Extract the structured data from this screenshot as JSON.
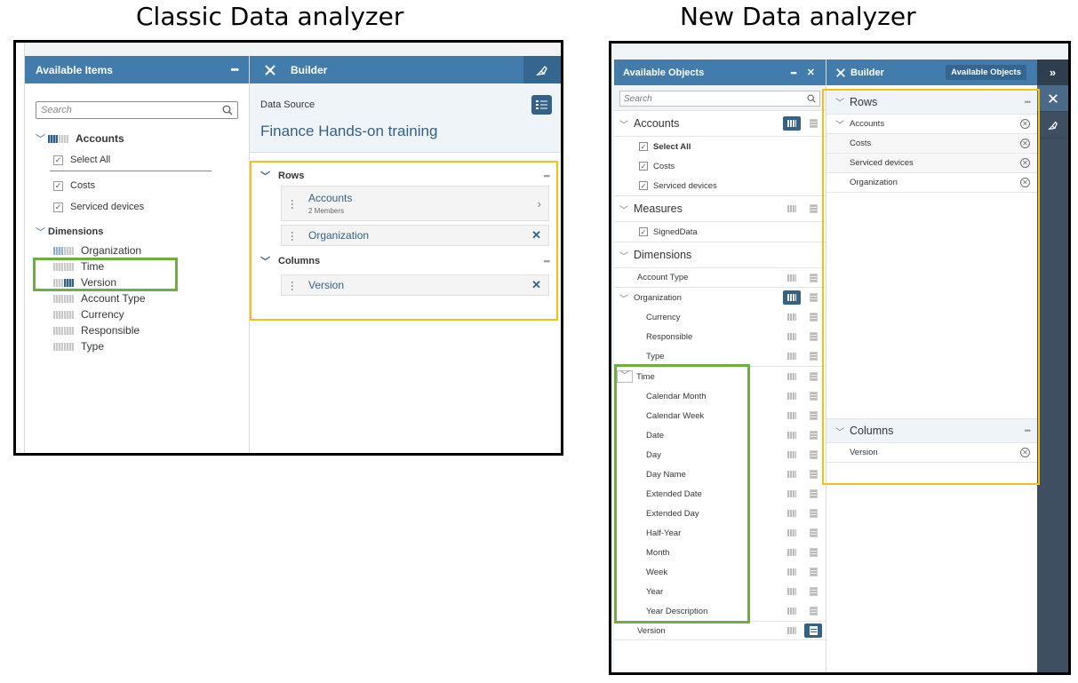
{
  "titles": {
    "classic": "Classic Data analyzer",
    "new": "New Data analyzer"
  },
  "classic": {
    "left_panel": {
      "title": "Available Items",
      "more": "•••",
      "search_placeholder": "Search",
      "accounts": {
        "label": "Accounts",
        "items": [
          {
            "label": "Select All",
            "checked": true
          },
          {
            "label": "Costs",
            "checked": true
          },
          {
            "label": "Serviced devices",
            "checked": true
          }
        ]
      },
      "dimensions": {
        "label": "Dimensions",
        "items": [
          "Organization",
          "Time",
          "Version",
          "Account Type",
          "Currency",
          "Responsible",
          "Type"
        ]
      }
    },
    "builder": {
      "title": "Builder",
      "data_source_label": "Data Source",
      "data_source_name": "Finance Hands-on training",
      "rows": {
        "label": "Rows",
        "more": "•••",
        "items": [
          {
            "label": "Accounts",
            "sub": "2 Members"
          },
          {
            "label": "Organization"
          }
        ]
      },
      "columns": {
        "label": "Columns",
        "more": "•••",
        "items": [
          {
            "label": "Version"
          }
        ]
      }
    }
  },
  "new": {
    "left_panel": {
      "title": "Available Objects",
      "more": "•••",
      "close": "✕",
      "search_placeholder": "Search",
      "accounts": {
        "label": "Accounts",
        "items": [
          "Select All",
          "Costs",
          "Serviced devices"
        ]
      },
      "measures": {
        "label": "Measures",
        "items": [
          "SignedData"
        ]
      },
      "dimensions": {
        "label": "Dimensions",
        "account_type": "Account Type",
        "organization": {
          "label": "Organization",
          "children": [
            "Currency",
            "Responsible",
            "Type"
          ]
        },
        "time": {
          "label": "Time",
          "children": [
            "Calendar Month",
            "Calendar Week",
            "Date",
            "Day",
            "Day Name",
            "Extended Date",
            "Extended Day",
            "Half-Year",
            "Month",
            "Week",
            "Year",
            "Year Description"
          ]
        },
        "version": "Version"
      }
    },
    "builder": {
      "title": "Builder",
      "available_objects_button": "Available Objects",
      "rows": {
        "label": "Rows",
        "more": "•••",
        "accounts": "Accounts",
        "account_members": [
          "Costs",
          "Serviced devices"
        ],
        "organization": "Organization"
      },
      "columns": {
        "label": "Columns",
        "more": "•••",
        "items": [
          "Version"
        ]
      }
    },
    "side": {
      "expand": "»"
    }
  }
}
